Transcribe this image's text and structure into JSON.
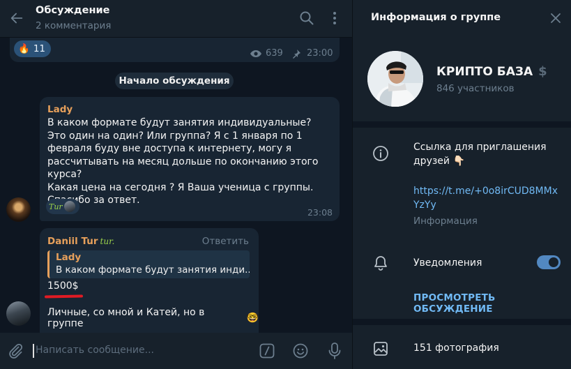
{
  "chat": {
    "title": "Обсуждение",
    "subtitle": "2 комментария",
    "post": {
      "reaction_emoji": "🔥",
      "reaction_count": "11",
      "views": "639",
      "time": "23:00"
    },
    "service_label": "Начало обсуждения",
    "messages": [
      {
        "author": "Lady",
        "text": "В каком формате будут занятия индивидуальные? Это один на один? Или группа? Я с 1 января по 1 февраля буду вне доступа к интернету, могу я рассчитывать на месяц дольше по окончанию этого курса?\nКакая цена на сегодня ? Я Ваша ученица с группы. Спасибо за ответ.",
        "reaction_tag": "Tur",
        "time": "23:08"
      },
      {
        "author": "Daniil Tur",
        "author_badge": "tur.",
        "reply_label": "Ответить",
        "quote_author": "Lady",
        "quote_text": "В каком формате будут занятия инди...",
        "price": "1500$",
        "text": "Личные, со мной и Катей, но в группе",
        "emoji": "🤓"
      }
    ],
    "composer_placeholder": "Написать сообщение..."
  },
  "panel": {
    "title": "Информация о группе",
    "group_name": "КРИПТО БАЗА",
    "group_name_suffix": "$",
    "members": "846 участников",
    "invite_title": "Ссылка для приглашения друзей 👇🏻",
    "invite_link": "https://t.me/+0o8irCUD8MMxYzYy",
    "invite_sub": "Информация",
    "notifications_label": "Уведомления",
    "notifications_on": true,
    "view_discussion": "ПРОСМОТРЕТЬ ОБСУЖДЕНИЕ",
    "photos": "151 фотография"
  },
  "colors": {
    "accent": "#71baf5",
    "author": "#e7a05b",
    "underline": "#e01b24",
    "toggle": "#5288c1"
  }
}
